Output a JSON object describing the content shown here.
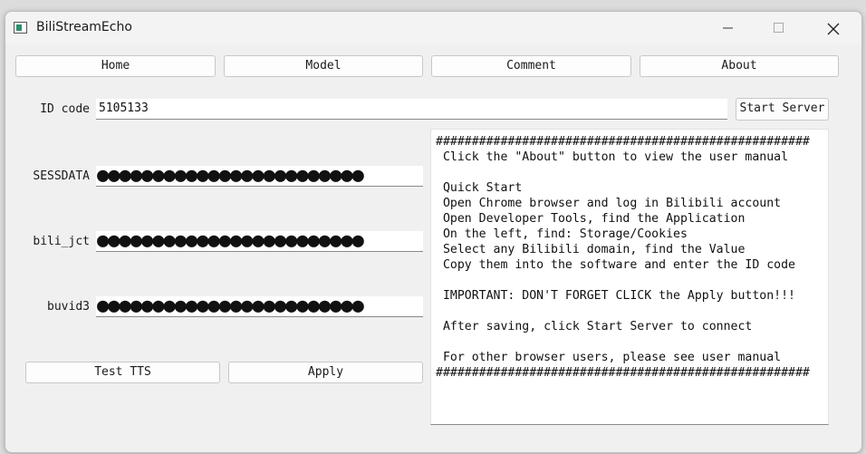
{
  "window": {
    "title": "BiliStreamEcho"
  },
  "nav": {
    "home": "Home",
    "model": "Model",
    "comment": "Comment",
    "about": "About"
  },
  "id": {
    "label": "ID code",
    "value": "5105133",
    "start_server": "Start Server"
  },
  "cookies": {
    "sessdata_label": "SESSDATA",
    "sessdata_value": "●●●●●●●●●●●●●●●●●●●●●●●●",
    "bili_jct_label": "bili_jct",
    "bili_jct_value": "●●●●●●●●●●●●●●●●●●●●●●●●",
    "buvid3_label": "buvid3",
    "buvid3_value": "●●●●●●●●●●●●●●●●●●●●●●●●"
  },
  "actions": {
    "test_tts": "Test TTS",
    "apply": "Apply"
  },
  "console": {
    "lines": [
      "####################################################",
      " Click the \"About\" button to view the user manual",
      "",
      " Quick Start",
      " Open Chrome browser and log in Bilibili account",
      " Open Developer Tools, find the Application",
      " On the left, find: Storage/Cookies",
      " Select any Bilibili domain, find the Value",
      " Copy them into the software and enter the ID code",
      "",
      " IMPORTANT: DON'T FORGET CLICK the Apply button!!!",
      "",
      " After saving, click Start Server to connect",
      "",
      " For other browser users, please see user manual",
      "####################################################"
    ]
  }
}
